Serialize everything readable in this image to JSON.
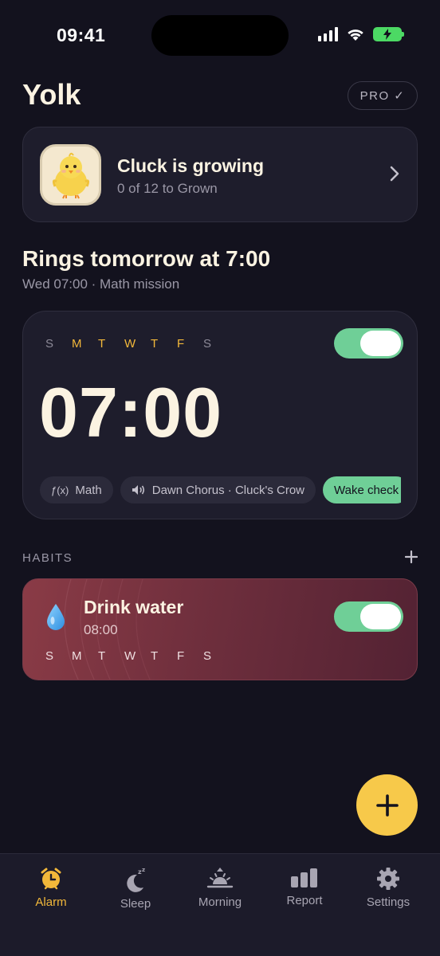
{
  "status_bar": {
    "time": "09:41"
  },
  "header": {
    "title": "Yolk",
    "pro_label": "PRO ✓"
  },
  "pet": {
    "title": "Cluck is growing",
    "subtitle": "0 of 12 to Grown"
  },
  "next_alarm": {
    "title": "Rings tomorrow at 7:00",
    "subtitle": "Wed 07:00 · Math mission"
  },
  "alarm": {
    "days": [
      {
        "label": "S",
        "active": false
      },
      {
        "label": "M",
        "active": true
      },
      {
        "label": "T",
        "active": true
      },
      {
        "label": "W",
        "active": true
      },
      {
        "label": "T",
        "active": true
      },
      {
        "label": "F",
        "active": true
      },
      {
        "label": "S",
        "active": false
      }
    ],
    "enabled": true,
    "time": "07:00",
    "chips": {
      "mission_icon": "ƒ(x)",
      "mission": "Math",
      "sound": "Dawn Chorus · Cluck's Crow",
      "wake_check": "Wake check"
    }
  },
  "habits": {
    "section_label": "HABITS",
    "items": [
      {
        "name": "Drink water",
        "time": "08:00",
        "enabled": true,
        "days": [
          "S",
          "M",
          "T",
          "W",
          "T",
          "F",
          "S"
        ]
      }
    ]
  },
  "tab_bar": {
    "tabs": [
      {
        "label": "Alarm",
        "icon": "alarm-clock-icon",
        "active": true
      },
      {
        "label": "Sleep",
        "icon": "moon-zzz-icon",
        "active": false
      },
      {
        "label": "Morning",
        "icon": "sunrise-icon",
        "active": false
      },
      {
        "label": "Report",
        "icon": "bar-chart-icon",
        "active": false
      },
      {
        "label": "Settings",
        "icon": "gear-icon",
        "active": false
      }
    ]
  },
  "colors": {
    "background": "#13121e",
    "card": "#1e1d2c",
    "accent": "#f2b83a",
    "toggle_on": "#6fcf97",
    "habit_card": "#7a3540"
  }
}
